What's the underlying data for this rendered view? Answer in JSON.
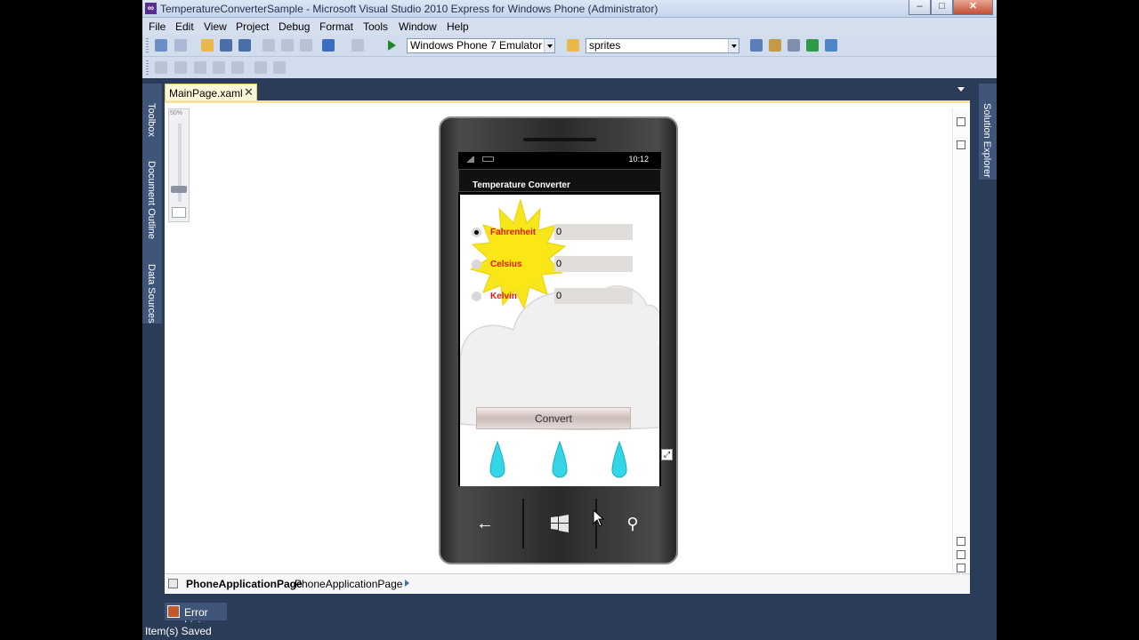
{
  "window": {
    "title": "TemperatureConverterSample - Microsoft Visual Studio 2010 Express for Windows Phone (Administrator)",
    "controls": {
      "minimize": "–",
      "maximize": "□",
      "close": "✕"
    }
  },
  "menu": [
    "File",
    "Edit",
    "View",
    "Project",
    "Debug",
    "Format",
    "Tools",
    "Window",
    "Help"
  ],
  "toolbar": {
    "target_device": "Windows Phone 7 Emulator",
    "find_combo": "sprites"
  },
  "dock": {
    "left": [
      "Toolbox",
      "Document Outline",
      "Data Sources"
    ],
    "right": [
      "Solution Explorer"
    ]
  },
  "document_tab": {
    "label": "MainPage.xaml",
    "close": "✕"
  },
  "designer": {
    "zoom": "50%",
    "phone": {
      "time": "10:12",
      "app_title": "Temperature Converter",
      "scales": [
        {
          "label": "Fahrenheit",
          "value": "0",
          "selected": true
        },
        {
          "label": "Celsius",
          "value": "0",
          "selected": false
        },
        {
          "label": "Kelvin",
          "value": "0",
          "selected": false
        }
      ],
      "convert_label": "Convert",
      "nav": {
        "back": "←",
        "search": "⚲"
      }
    }
  },
  "breadcrumb": {
    "element_type": "PhoneApplicationPage",
    "element_name": "PhoneApplicationPage"
  },
  "error_list": {
    "label": "Error List"
  },
  "status": {
    "text": "Item(s) Saved"
  }
}
